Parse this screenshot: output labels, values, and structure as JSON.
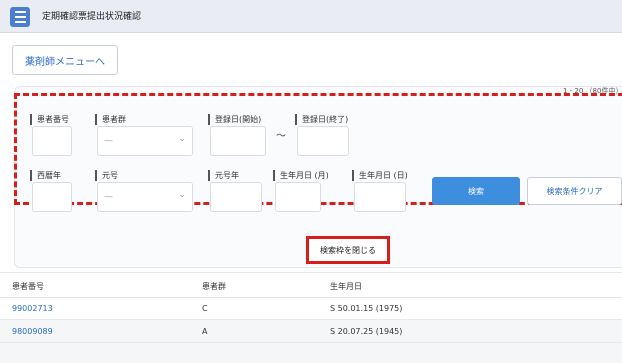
{
  "header": {
    "title": "定期確認票提出状況確認"
  },
  "nav": {
    "pharmacist_menu": "薬剤師メニューへ"
  },
  "result_count": "1 - 20 （80件中）",
  "search": {
    "patient_no_label": "患者番号",
    "patient_group_label": "患者群",
    "patient_group_value": "—",
    "reg_start_label": "登録日(開始)",
    "reg_end_label": "登録日(終了)",
    "range_sep": "〜",
    "western_year_label": "西暦年",
    "era_label": "元号",
    "era_value": "—",
    "era_year_label": "元号年",
    "birth_month_label": "生年月日 (月)",
    "birth_day_label": "生年月日 (日)",
    "search_button": "検索",
    "clear_button": "検索条件クリア",
    "close_button": "検索枠を閉じる"
  },
  "table": {
    "headers": [
      "患者番号",
      "患者群",
      "生年月日"
    ],
    "rows": [
      [
        "99002713",
        "C",
        "S 50.01.15 (1975)"
      ],
      [
        "98009089",
        "A",
        "S 20.07.25 (1945)"
      ]
    ]
  }
}
